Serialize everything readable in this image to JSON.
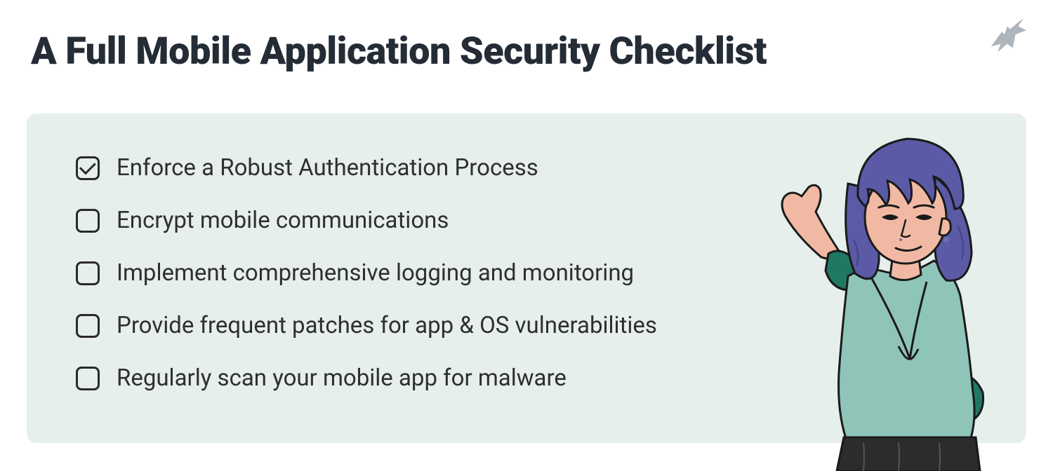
{
  "title": "A Full Mobile Application Security Checklist",
  "checklist": {
    "items": [
      {
        "label": "Enforce a Robust Authentication Process",
        "checked": true
      },
      {
        "label": "Encrypt mobile communications",
        "checked": false
      },
      {
        "label": "Implement comprehensive logging and monitoring",
        "checked": false
      },
      {
        "label": "Provide frequent patches for app & OS vulnerabilities",
        "checked": false
      },
      {
        "label": "Regularly scan your mobile app for malware",
        "checked": false
      }
    ]
  },
  "colors": {
    "card_bg": "#e6efec",
    "title": "#242c36",
    "text": "#2f2f2f",
    "logo": "#a6adb5",
    "hair": "#5b5aa6",
    "skin": "#f1b9a3",
    "shirt": "#8fc4b8",
    "shirt_dark": "#1f7864",
    "pants": "#2c2c2c"
  }
}
